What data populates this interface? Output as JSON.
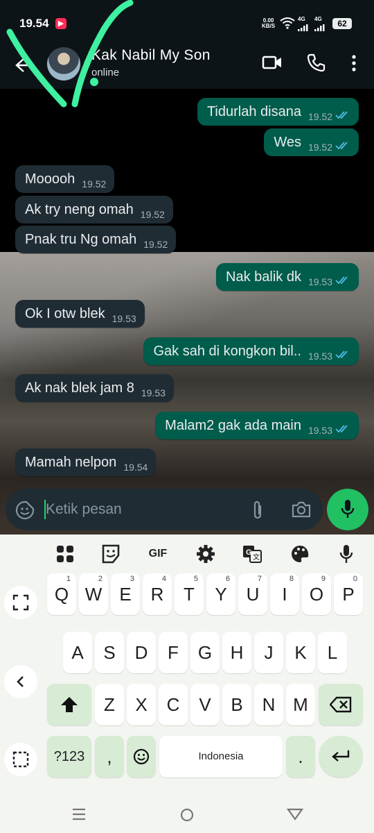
{
  "status_bar": {
    "time": "19.54",
    "net_speed_value": "0.00",
    "net_speed_unit": "KB/S",
    "sim1": "4G",
    "sim2": "4G",
    "battery": "62"
  },
  "app_bar": {
    "contact_name": "Kak Nabil My Son",
    "status": "online"
  },
  "messages": [
    {
      "dir": "out",
      "text": "Tidurlah disana",
      "time": "19.52"
    },
    {
      "dir": "out",
      "text": "Wes",
      "time": "19.52"
    },
    {
      "dir": "in",
      "text": "Mooooh",
      "time": "19.52"
    },
    {
      "dir": "in",
      "text": "Ak try neng omah",
      "time": "19.52"
    },
    {
      "dir": "in",
      "text": "Pnak tru Ng omah",
      "time": "19.52"
    },
    {
      "dir": "out",
      "text": "Nak balik dk",
      "time": "19.53"
    },
    {
      "dir": "in",
      "text": "Ok I otw blek",
      "time": "19.53"
    },
    {
      "dir": "out",
      "text": "Gak sah di kongkon bil..",
      "time": "19.53"
    },
    {
      "dir": "in",
      "text": "Ak nak blek jam 8",
      "time": "19.53"
    },
    {
      "dir": "out",
      "text": "Malam2 gak ada main",
      "time": "19.53"
    },
    {
      "dir": "in",
      "text": "Mamah nelpon",
      "time": "19.54"
    }
  ],
  "composer": {
    "placeholder": "Ketik pesan"
  },
  "keyboard": {
    "toolbar": {
      "gif": "GIF"
    },
    "row1": [
      {
        "k": "Q",
        "n": "1"
      },
      {
        "k": "W",
        "n": "2"
      },
      {
        "k": "E",
        "n": "3"
      },
      {
        "k": "R",
        "n": "4"
      },
      {
        "k": "T",
        "n": "5"
      },
      {
        "k": "Y",
        "n": "6"
      },
      {
        "k": "U",
        "n": "7"
      },
      {
        "k": "I",
        "n": "8"
      },
      {
        "k": "O",
        "n": "9"
      },
      {
        "k": "P",
        "n": "0"
      }
    ],
    "row2": [
      "A",
      "S",
      "D",
      "F",
      "G",
      "H",
      "J",
      "K",
      "L"
    ],
    "row3": [
      "Z",
      "X",
      "C",
      "V",
      "B",
      "N",
      "M"
    ],
    "symbols_label": "?123",
    "comma": ",",
    "space_label": "Indonesia",
    "period": "."
  },
  "colors": {
    "outgoing": "#005c4b",
    "incoming": "#202c33",
    "accent": "#21c063",
    "read_ticks": "#53bdeb",
    "annotation": "#3ef0a0"
  }
}
